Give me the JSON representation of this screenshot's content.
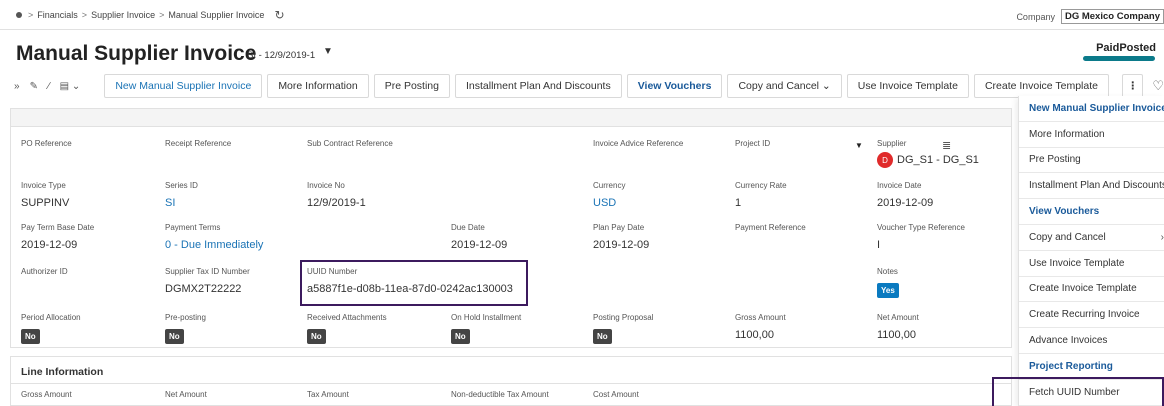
{
  "breadcrumb": {
    "items": [
      "Financials",
      "Supplier Invoice",
      "Manual Supplier Invoice"
    ]
  },
  "company": {
    "label": "Company",
    "value": "DG Mexico Company"
  },
  "page": {
    "title": "Manual Supplier Invoice",
    "subtitle": "SI - 12/9/2019-1",
    "status": "PaidPosted"
  },
  "toolbar": {
    "buttons": [
      "New Manual Supplier Invoice",
      "More Information",
      "Pre Posting",
      "Installment Plan And Discounts",
      "View Vouchers",
      "Copy and Cancel",
      "Use Invoice Template",
      "Create Invoice Template"
    ],
    "more_label": "⋮"
  },
  "form": {
    "po_reference": {
      "label": "PO Reference",
      "value": ""
    },
    "receipt_reference": {
      "label": "Receipt Reference",
      "value": ""
    },
    "sub_contract_reference": {
      "label": "Sub Contract Reference",
      "value": ""
    },
    "invoice_advice_reference": {
      "label": "Invoice Advice Reference",
      "value": ""
    },
    "project_id": {
      "label": "Project ID",
      "value": ""
    },
    "supplier": {
      "label": "Supplier",
      "avatar": "D",
      "value": "DG_S1 - DG_S1"
    },
    "invoice_type": {
      "label": "Invoice Type",
      "value": "SUPPINV"
    },
    "series_id": {
      "label": "Series ID",
      "value": "SI"
    },
    "invoice_no": {
      "label": "Invoice No",
      "value": "12/9/2019-1"
    },
    "currency": {
      "label": "Currency",
      "value": "USD"
    },
    "currency_rate": {
      "label": "Currency Rate",
      "value": "1"
    },
    "invoice_date": {
      "label": "Invoice Date",
      "value": "2019-12-09"
    },
    "pay_term_base_date": {
      "label": "Pay Term Base Date",
      "value": "2019-12-09"
    },
    "payment_terms": {
      "label": "Payment Terms",
      "value": "0 - Due Immediately"
    },
    "due_date": {
      "label": "Due Date",
      "value": "2019-12-09"
    },
    "plan_pay_date": {
      "label": "Plan Pay Date",
      "value": "2019-12-09"
    },
    "payment_reference": {
      "label": "Payment Reference",
      "value": ""
    },
    "voucher_type_reference": {
      "label": "Voucher Type Reference",
      "value": "I"
    },
    "authorizer_id": {
      "label": "Authorizer ID",
      "value": ""
    },
    "supplier_tax_id": {
      "label": "Supplier Tax ID Number",
      "value": "DGMX2T22222"
    },
    "uuid_number": {
      "label": "UUID Number",
      "value": "a5887f1e-d08b-11ea-87d0-0242ac130003"
    },
    "notes": {
      "label": "Notes",
      "value": "Yes"
    },
    "period_allocation": {
      "label": "Period Allocation",
      "value": "No"
    },
    "pre_posting": {
      "label": "Pre-posting",
      "value": "No"
    },
    "received_attachments": {
      "label": "Received Attachments",
      "value": "No"
    },
    "on_hold_installment": {
      "label": "On Hold Installment",
      "value": "No"
    },
    "posting_proposal": {
      "label": "Posting Proposal",
      "value": "No"
    },
    "gross_amount": {
      "label": "Gross Amount",
      "value": "1100,00"
    },
    "net_amount": {
      "label": "Net Amount",
      "value": "1100,00"
    }
  },
  "line_information": {
    "title": "Line Information",
    "columns": [
      "Gross Amount",
      "Net Amount",
      "Tax Amount",
      "Non-deductible Tax Amount",
      "Cost Amount"
    ]
  },
  "dropdown": {
    "items": [
      {
        "label": "New Manual Supplier Invoice",
        "style": "blue"
      },
      {
        "label": "More Information",
        "style": "normal"
      },
      {
        "label": "Pre Posting",
        "style": "normal"
      },
      {
        "label": "Installment Plan And Discounts",
        "style": "normal"
      },
      {
        "label": "View Vouchers",
        "style": "blue"
      },
      {
        "label": "Copy and Cancel",
        "style": "normal"
      },
      {
        "label": "Use Invoice Template",
        "style": "normal"
      },
      {
        "label": "Create Invoice Template",
        "style": "normal"
      },
      {
        "label": "Create Recurring Invoice",
        "style": "normal"
      },
      {
        "label": "Advance Invoices",
        "style": "normal"
      },
      {
        "label": "Project Reporting",
        "style": "blue"
      },
      {
        "label": "Fetch UUID Number",
        "style": "normal"
      }
    ]
  },
  "colors": {
    "accent": "#1a73b5",
    "status_bar": "#0b7a8a",
    "highlight_border": "#3c1a5e",
    "avatar": "#e02b2b"
  }
}
